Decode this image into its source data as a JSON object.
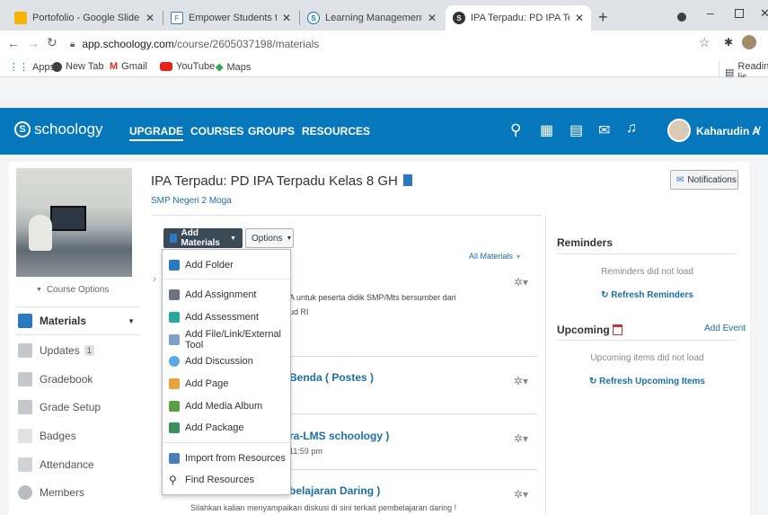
{
  "browser": {
    "tabs": [
      {
        "title": "Portofolio - Google Slide",
        "favicon": "slides-icon"
      },
      {
        "title": "Empower Students to Do Their B",
        "favicon": "flipgrid-icon"
      },
      {
        "title": "Learning Management System |",
        "favicon": "schoology-icon"
      },
      {
        "title": "IPA Terpadu: PD IPA Terpadu Kela",
        "favicon": "schoology-icon"
      }
    ],
    "url_host": "app.schoology.com",
    "url_path": "/course/2605037198/materials",
    "bookmarks": [
      "Apps",
      "New Tab",
      "Gmail",
      "YouTube",
      "Maps"
    ],
    "reading_list": "Reading lis"
  },
  "header": {
    "logo": "schoology",
    "nav": [
      "UPGRADE",
      "COURSES",
      "GROUPS",
      "RESOURCES"
    ],
    "user": "Kaharudin A"
  },
  "left": {
    "course_options": "Course Options",
    "items": [
      {
        "label": "Materials",
        "icon": "materials-icon"
      },
      {
        "label": "Updates",
        "badge": "1",
        "icon": "updates-icon"
      },
      {
        "label": "Gradebook",
        "icon": "gradebook-icon"
      },
      {
        "label": "Grade Setup",
        "icon": "grade-setup-icon"
      },
      {
        "label": "Badges",
        "icon": "badges-icon"
      },
      {
        "label": "Attendance",
        "icon": "attendance-icon"
      },
      {
        "label": "Members",
        "icon": "members-icon"
      }
    ]
  },
  "main": {
    "title": "IPA Terpadu: PD IPA Terpadu Kelas 8 GH",
    "school": "SMP Negeri 2 Moga",
    "notifications": "Notifications",
    "add_materials": "Add Materials",
    "options": "Options",
    "all_materials": "All Materials",
    "menu": [
      "Add Folder",
      "Add Assignment",
      "Add Assessment",
      "Add File/Link/External Tool",
      "Add Discussion",
      "Add Page",
      "Add Media Album",
      "Add Package",
      "Import from Resources",
      "Find Resources"
    ],
    "rows": [
      {
        "line1": "A untuk peserta didik SMP/Mts bersumber dari",
        "line2": "ud RI"
      },
      {
        "title": "Benda ( Postes )"
      },
      {
        "title": "ra-LMS schoology )",
        "line2": "11:59 pm"
      },
      {
        "title": "belajaran Daring )",
        "line2": "Silahkan kalian menyampaikan diskusi di sini terkait pembelajaran daring !"
      }
    ]
  },
  "right": {
    "reminders": "Reminders",
    "reminders_msg": "Reminders did not load",
    "refresh_reminders": "Refresh Reminders",
    "upcoming": "Upcoming",
    "add_event": "Add Event",
    "upcoming_msg": "Upcoming items did not load",
    "refresh_upcoming": "Refresh Upcoming Items"
  }
}
